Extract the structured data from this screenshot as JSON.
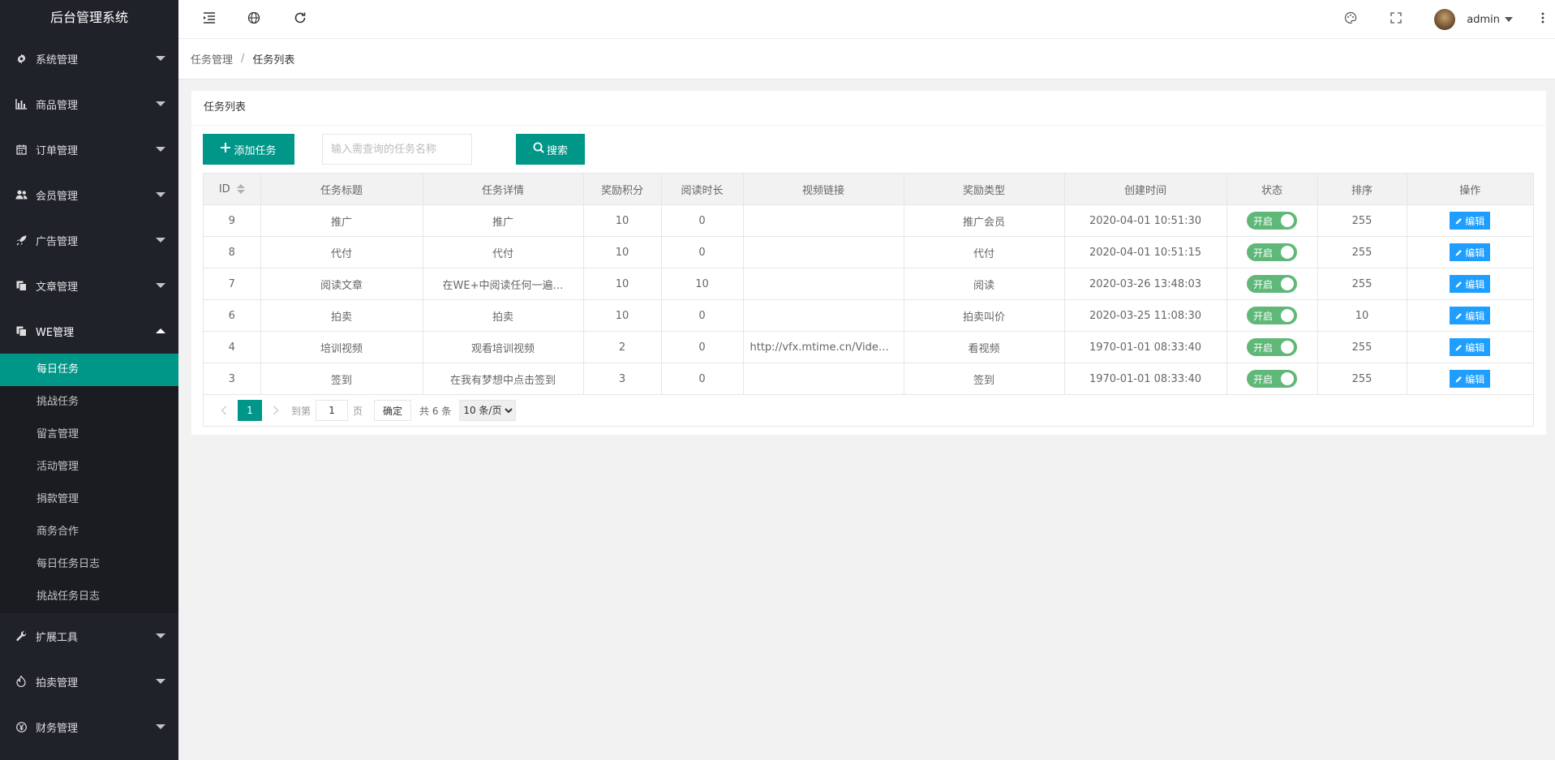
{
  "app": {
    "title": "后台管理系统"
  },
  "sidebar": {
    "items": [
      {
        "label": "系统管理",
        "icon": "gear-icon"
      },
      {
        "label": "商品管理",
        "icon": "chart-icon"
      },
      {
        "label": "订单管理",
        "icon": "calendar-icon"
      },
      {
        "label": "会员管理",
        "icon": "users-icon"
      },
      {
        "label": "广告管理",
        "icon": "rocket-icon"
      },
      {
        "label": "文章管理",
        "icon": "copy-icon"
      },
      {
        "label": "WE管理",
        "icon": "copy-icon",
        "expanded": true,
        "children": [
          "每日任务",
          "挑战任务",
          "留言管理",
          "活动管理",
          "捐款管理",
          "商务合作",
          "每日任务日志",
          "挑战任务日志"
        ],
        "active_child": "每日任务"
      },
      {
        "label": "扩展工具",
        "icon": "wrench-icon"
      },
      {
        "label": "拍卖管理",
        "icon": "fire-icon"
      },
      {
        "label": "财务管理",
        "icon": "yen-icon"
      }
    ]
  },
  "header": {
    "user": "admin"
  },
  "breadcrumb": {
    "parent": "任务管理",
    "current": "任务列表",
    "separator": "/"
  },
  "card": {
    "title": "任务列表"
  },
  "toolbar": {
    "add_label": "添加任务",
    "search_placeholder": "输入需查询的任务名称",
    "search_value": "",
    "search_label": "搜索"
  },
  "table": {
    "columns": [
      "ID",
      "任务标题",
      "任务详情",
      "奖励积分",
      "阅读时长",
      "视频链接",
      "奖励类型",
      "创建时间",
      "状态",
      "排序",
      "操作"
    ],
    "rows": [
      {
        "id": "9",
        "title": "推广",
        "detail": "推广",
        "points": "10",
        "duration": "0",
        "video": "",
        "reward_type": "推广会员",
        "created": "2020-04-01 10:51:30",
        "status": "开启",
        "sort": "255",
        "action": "编辑"
      },
      {
        "id": "8",
        "title": "代付",
        "detail": "代付",
        "points": "10",
        "duration": "0",
        "video": "",
        "reward_type": "代付",
        "created": "2020-04-01 10:51:15",
        "status": "开启",
        "sort": "255",
        "action": "编辑"
      },
      {
        "id": "7",
        "title": "阅读文章",
        "detail": "在WE+中阅读任何一遍…",
        "points": "10",
        "duration": "10",
        "video": "",
        "reward_type": "阅读",
        "created": "2020-03-26 13:48:03",
        "status": "开启",
        "sort": "255",
        "action": "编辑"
      },
      {
        "id": "6",
        "title": "拍卖",
        "detail": "拍卖",
        "points": "10",
        "duration": "0",
        "video": "",
        "reward_type": "拍卖叫价",
        "created": "2020-03-25 11:08:30",
        "status": "开启",
        "sort": "10",
        "action": "编辑"
      },
      {
        "id": "4",
        "title": "培训视频",
        "detail": "观看培训视频",
        "points": "2",
        "duration": "0",
        "video": "http://vfx.mtime.cn/Vide…",
        "reward_type": "看视频",
        "created": "1970-01-01 08:33:40",
        "status": "开启",
        "sort": "255",
        "action": "编辑"
      },
      {
        "id": "3",
        "title": "签到",
        "detail": "在我有梦想中点击签到",
        "points": "3",
        "duration": "0",
        "video": "",
        "reward_type": "签到",
        "created": "1970-01-01 08:33:40",
        "status": "开启",
        "sort": "255",
        "action": "编辑"
      }
    ]
  },
  "pagination": {
    "current": "1",
    "goto_label": "到第",
    "goto_value": "1",
    "page_unit": "页",
    "confirm_label": "确定",
    "total_label": "共 6 条",
    "page_size": "10 条/页"
  },
  "colors": {
    "primary": "#009688",
    "sidebar": "#20222a",
    "switch_on": "#5fb878",
    "edit": "#1e9fff"
  }
}
